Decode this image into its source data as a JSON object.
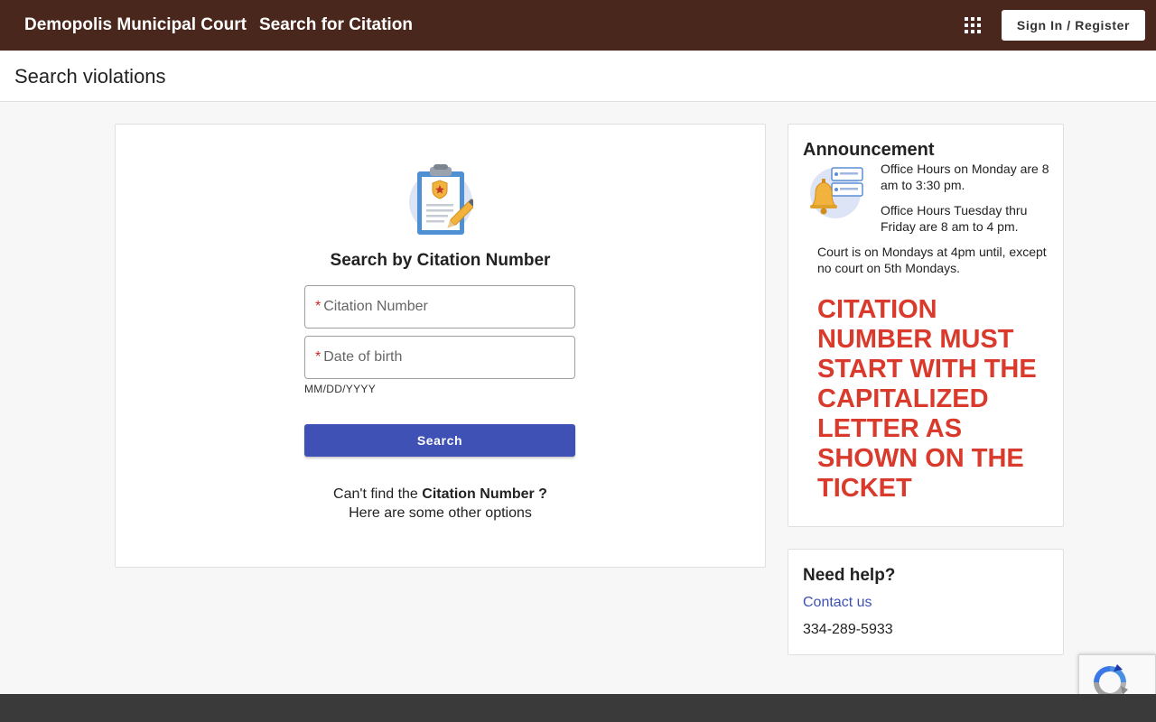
{
  "header": {
    "brand": "Demopolis Municipal Court",
    "page_name": "Search for Citation",
    "signin_label": "Sign In / Register",
    "bg_color": "#4a271c"
  },
  "subheader": {
    "title": "Search violations"
  },
  "search": {
    "title": "Search by Citation Number",
    "citation_placeholder": "Citation Number",
    "citation_value": "",
    "dob_placeholder": "Date of birth",
    "dob_value": "",
    "required_mark": "*",
    "dob_hint": "MM/DD/YYYY",
    "button_label": "Search",
    "button_color": "#3f51b5",
    "cant_find_prefix": "Can't find the",
    "cant_find_bold": "Citation Number ?",
    "other_options": "Here are some other options"
  },
  "announcement": {
    "title": "Announcement",
    "p1": "Office Hours on Monday are 8 am to 3:30 pm.",
    "p2": "Office Hours Tuesday thru Friday are 8 am to 4 pm.",
    "p3": "Court is on Mondays at 4pm until, except no court on 5th Mondays.",
    "warning": "CITATION NUMBER MUST START WITH THE CAPITALIZED LETTER AS SHOWN ON THE TICKET",
    "warning_color": "#d93a2b"
  },
  "help": {
    "title": "Need help?",
    "contact_label": "Contact us",
    "phone": "334-289-5933"
  },
  "icons": {
    "apps": "apps-grid-icon",
    "clipboard": "clipboard-badge-icon",
    "bell": "bell-notification-icon",
    "recaptcha": "recaptcha-icon"
  }
}
